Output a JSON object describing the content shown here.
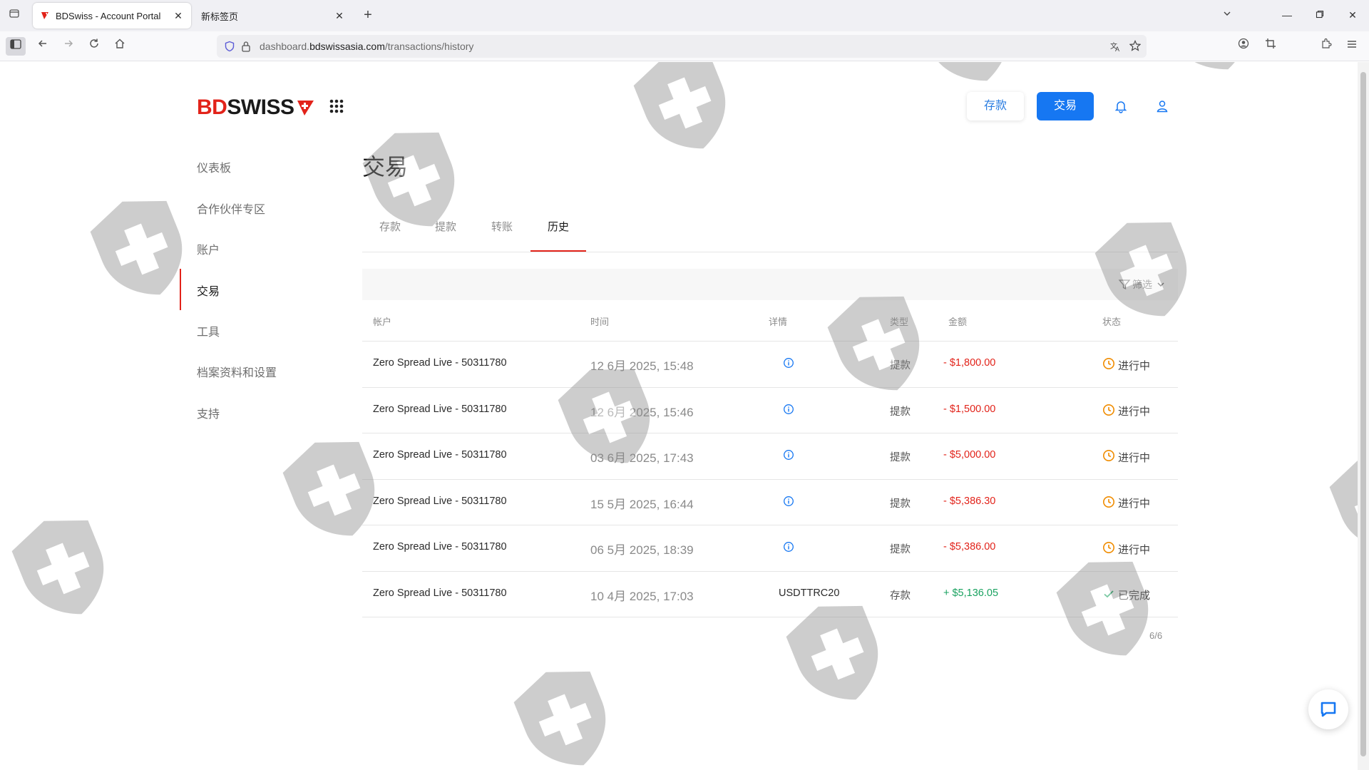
{
  "browser": {
    "tabs": [
      {
        "title": "BDSwiss - Account Portal",
        "active": true
      },
      {
        "title": "新标签页",
        "active": false
      }
    ],
    "url": {
      "prefix": "dashboard.",
      "host": "bdswissasia.com",
      "path": "/transactions/history"
    }
  },
  "header": {
    "logo_left": "BD",
    "logo_right": "SWISS",
    "deposit_label": "存款",
    "trade_label": "交易"
  },
  "sidebar": {
    "items": [
      {
        "label": "仪表板"
      },
      {
        "label": "合作伙伴专区"
      },
      {
        "label": "账户"
      },
      {
        "label": "交易"
      },
      {
        "label": "工具"
      },
      {
        "label": "档案资料和设置"
      },
      {
        "label": "支持"
      }
    ],
    "active_index": 3
  },
  "main": {
    "title": "交易",
    "tabs": [
      {
        "label": "存款"
      },
      {
        "label": "提款"
      },
      {
        "label": "转账"
      },
      {
        "label": "历史"
      }
    ],
    "active_tab": 3,
    "filter_label": "筛选",
    "columns": [
      "帐户",
      "时间",
      "详情",
      "类型",
      "金额",
      "状态"
    ],
    "rows": [
      {
        "account": "Zero Spread Live - 50311780",
        "time": "12 6月 2025, 15:48",
        "detail": "",
        "type": "提款",
        "amount": "- $1,800.00",
        "status": "进行中",
        "direction": "out"
      },
      {
        "account": "Zero Spread Live - 50311780",
        "time": "12 6月 2025, 15:46",
        "detail": "",
        "type": "提款",
        "amount": "- $1,500.00",
        "status": "进行中",
        "direction": "out"
      },
      {
        "account": "Zero Spread Live - 50311780",
        "time": "03 6月 2025, 17:43",
        "detail": "",
        "type": "提款",
        "amount": "- $5,000.00",
        "status": "进行中",
        "direction": "out"
      },
      {
        "account": "Zero Spread Live - 50311780",
        "time": "15 5月 2025, 16:44",
        "detail": "",
        "type": "提款",
        "amount": "- $5,386.30",
        "status": "进行中",
        "direction": "out"
      },
      {
        "account": "Zero Spread Live - 50311780",
        "time": "06 5月 2025, 18:39",
        "detail": "",
        "type": "提款",
        "amount": "- $5,386.00",
        "status": "进行中",
        "direction": "out"
      },
      {
        "account": "Zero Spread Live - 50311780",
        "time": "10 4月 2025, 17:03",
        "detail": "USDTTRC20",
        "type": "存款",
        "amount": "+ $5,136.05",
        "status": "已完成",
        "direction": "in"
      }
    ],
    "pagination": "6/6"
  },
  "colors": {
    "brand_red": "#e2231a",
    "primary_blue": "#1677f2",
    "pending_orange": "#f08c00",
    "success_green": "#1aa260"
  }
}
